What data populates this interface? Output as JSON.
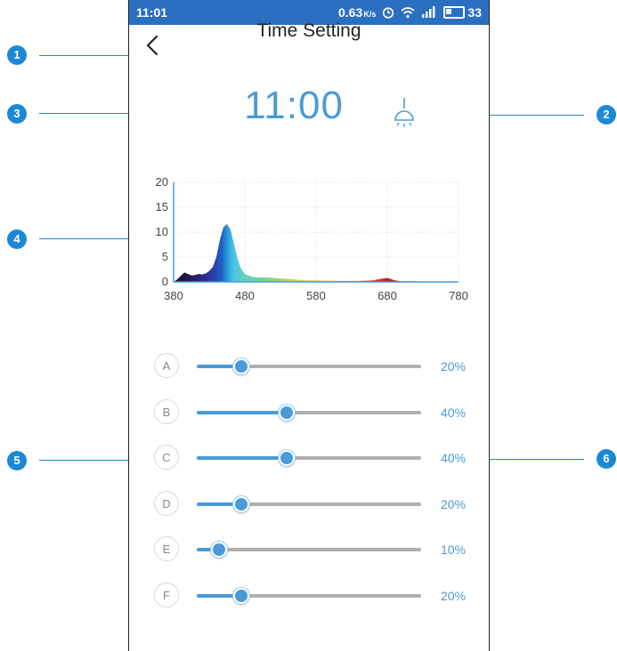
{
  "status_bar": {
    "time": "11:01",
    "network_speed": "0.63",
    "speed_unit": "K/s",
    "icons": [
      "alarm-icon",
      "wifi-icon",
      "signal-icon"
    ],
    "battery": "33",
    "bg_color": "#2b6fc1"
  },
  "header": {
    "back_icon": "chevron-left-icon",
    "title": "Time Setting"
  },
  "clock": {
    "time": "11:00",
    "light_icon": "ceiling-lamp-icon",
    "color": "#4a9ad8"
  },
  "chart_data": {
    "type": "area",
    "xlim": [
      380,
      780
    ],
    "ylim": [
      0,
      20
    ],
    "x_ticks": [
      380,
      480,
      580,
      680,
      780
    ],
    "y_ticks": [
      0,
      5,
      10,
      15,
      20
    ],
    "grid": true,
    "series": [
      {
        "x": [
          380,
          385,
          390,
          395,
          400,
          405,
          410,
          415,
          420,
          425,
          430,
          435,
          440,
          445,
          450,
          455,
          460,
          465,
          470,
          475,
          480,
          490,
          500,
          510,
          520,
          530,
          540,
          550,
          560,
          570,
          580,
          600,
          620,
          640,
          660,
          670,
          680,
          685,
          690,
          700,
          720,
          740,
          760,
          780
        ],
        "y": [
          0,
          0.5,
          1.2,
          1.9,
          1.6,
          1.3,
          1.4,
          1.6,
          1.5,
          1.7,
          2.2,
          3.0,
          5.0,
          8.5,
          11.0,
          11.6,
          10.5,
          7.5,
          4.5,
          2.6,
          1.6,
          1.0,
          0.9,
          0.9,
          0.8,
          0.7,
          0.6,
          0.5,
          0.4,
          0.35,
          0.3,
          0.25,
          0.2,
          0.2,
          0.3,
          0.6,
          0.8,
          0.6,
          0.3,
          0.15,
          0.1,
          0.05,
          0.02,
          0
        ]
      }
    ]
  },
  "channels": [
    {
      "label": "A",
      "value": 20,
      "percent_text": "20%"
    },
    {
      "label": "B",
      "value": 40,
      "percent_text": "40%"
    },
    {
      "label": "C",
      "value": 40,
      "percent_text": "40%"
    },
    {
      "label": "D",
      "value": 20,
      "percent_text": "20%"
    },
    {
      "label": "E",
      "value": 10,
      "percent_text": "10%"
    },
    {
      "label": "F",
      "value": 20,
      "percent_text": "20%"
    }
  ],
  "callouts": [
    "1",
    "2",
    "3",
    "4",
    "5",
    "6"
  ],
  "accent_color": "#4a9ad8",
  "callout_color": "#1c88d6"
}
